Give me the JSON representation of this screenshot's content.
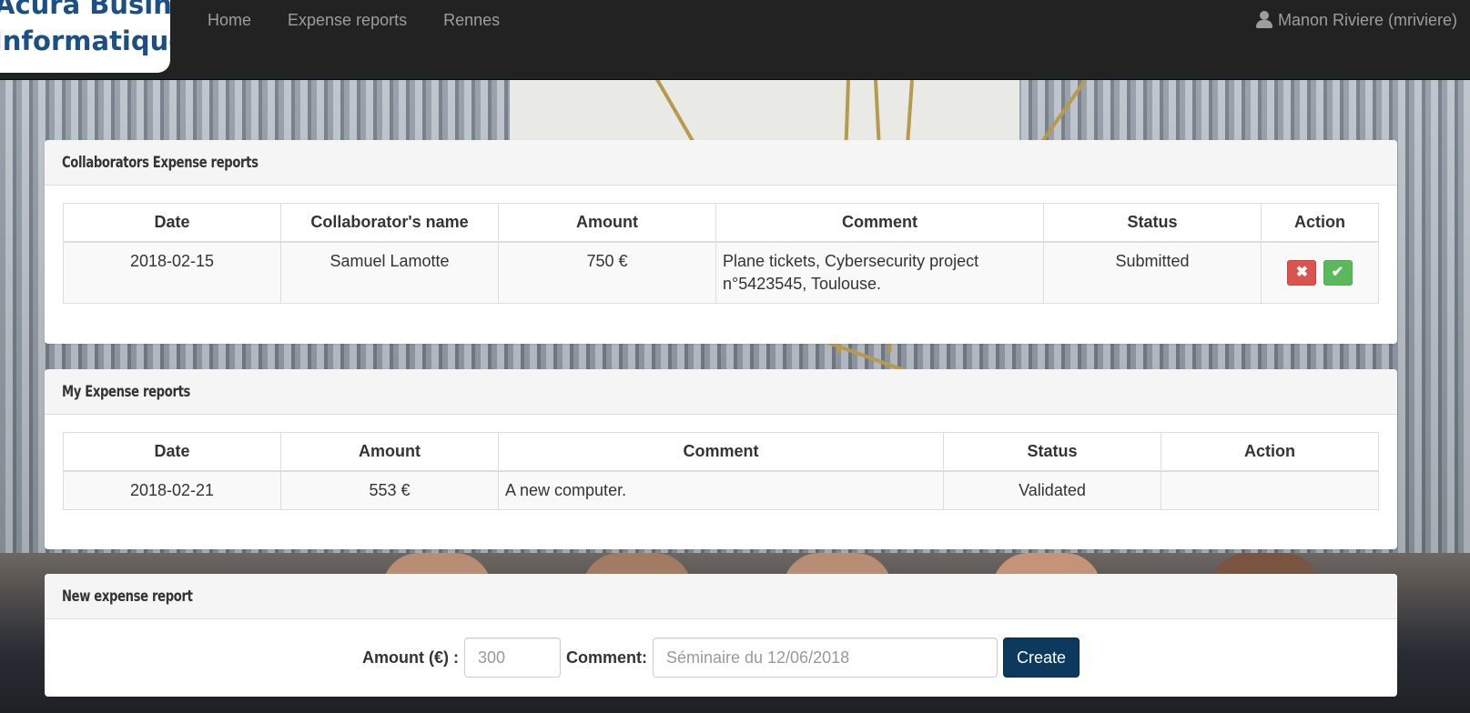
{
  "brand": {
    "line1": "Acura Business",
    "line2": "Informatique"
  },
  "nav": {
    "links": [
      "Home",
      "Expense reports",
      "Rennes"
    ],
    "user": "Manon Riviere (mriviere)"
  },
  "collaborators_panel": {
    "title": "Collaborators Expense reports",
    "columns": [
      "Date",
      "Collaborator's name",
      "Amount",
      "Comment",
      "Status",
      "Action"
    ],
    "rows": [
      {
        "date": "2018-02-15",
        "name": "Samuel Lamotte",
        "amount": "750 €",
        "comment": "Plane tickets, Cybersecurity project n°5423545, Toulouse.",
        "status": "Submitted",
        "reject_icon": "✖",
        "accept_icon": "✔"
      }
    ]
  },
  "my_panel": {
    "title": "My Expense reports",
    "columns": [
      "Date",
      "Amount",
      "Comment",
      "Status",
      "Action"
    ],
    "rows": [
      {
        "date": "2018-02-21",
        "amount": "553 €",
        "comment": "A new computer.",
        "status": "Validated",
        "action": ""
      }
    ]
  },
  "new_panel": {
    "title": "New expense report",
    "amount_label": "Amount (€) :",
    "amount_placeholder": "300",
    "comment_label": "Comment:",
    "comment_placeholder": "Séminaire du 12/06/2018",
    "create_label": "Create"
  },
  "colors": {
    "navbar": "#222222",
    "reject": "#d9534f",
    "accept": "#5cb85c",
    "create": "#0b3a5e"
  }
}
